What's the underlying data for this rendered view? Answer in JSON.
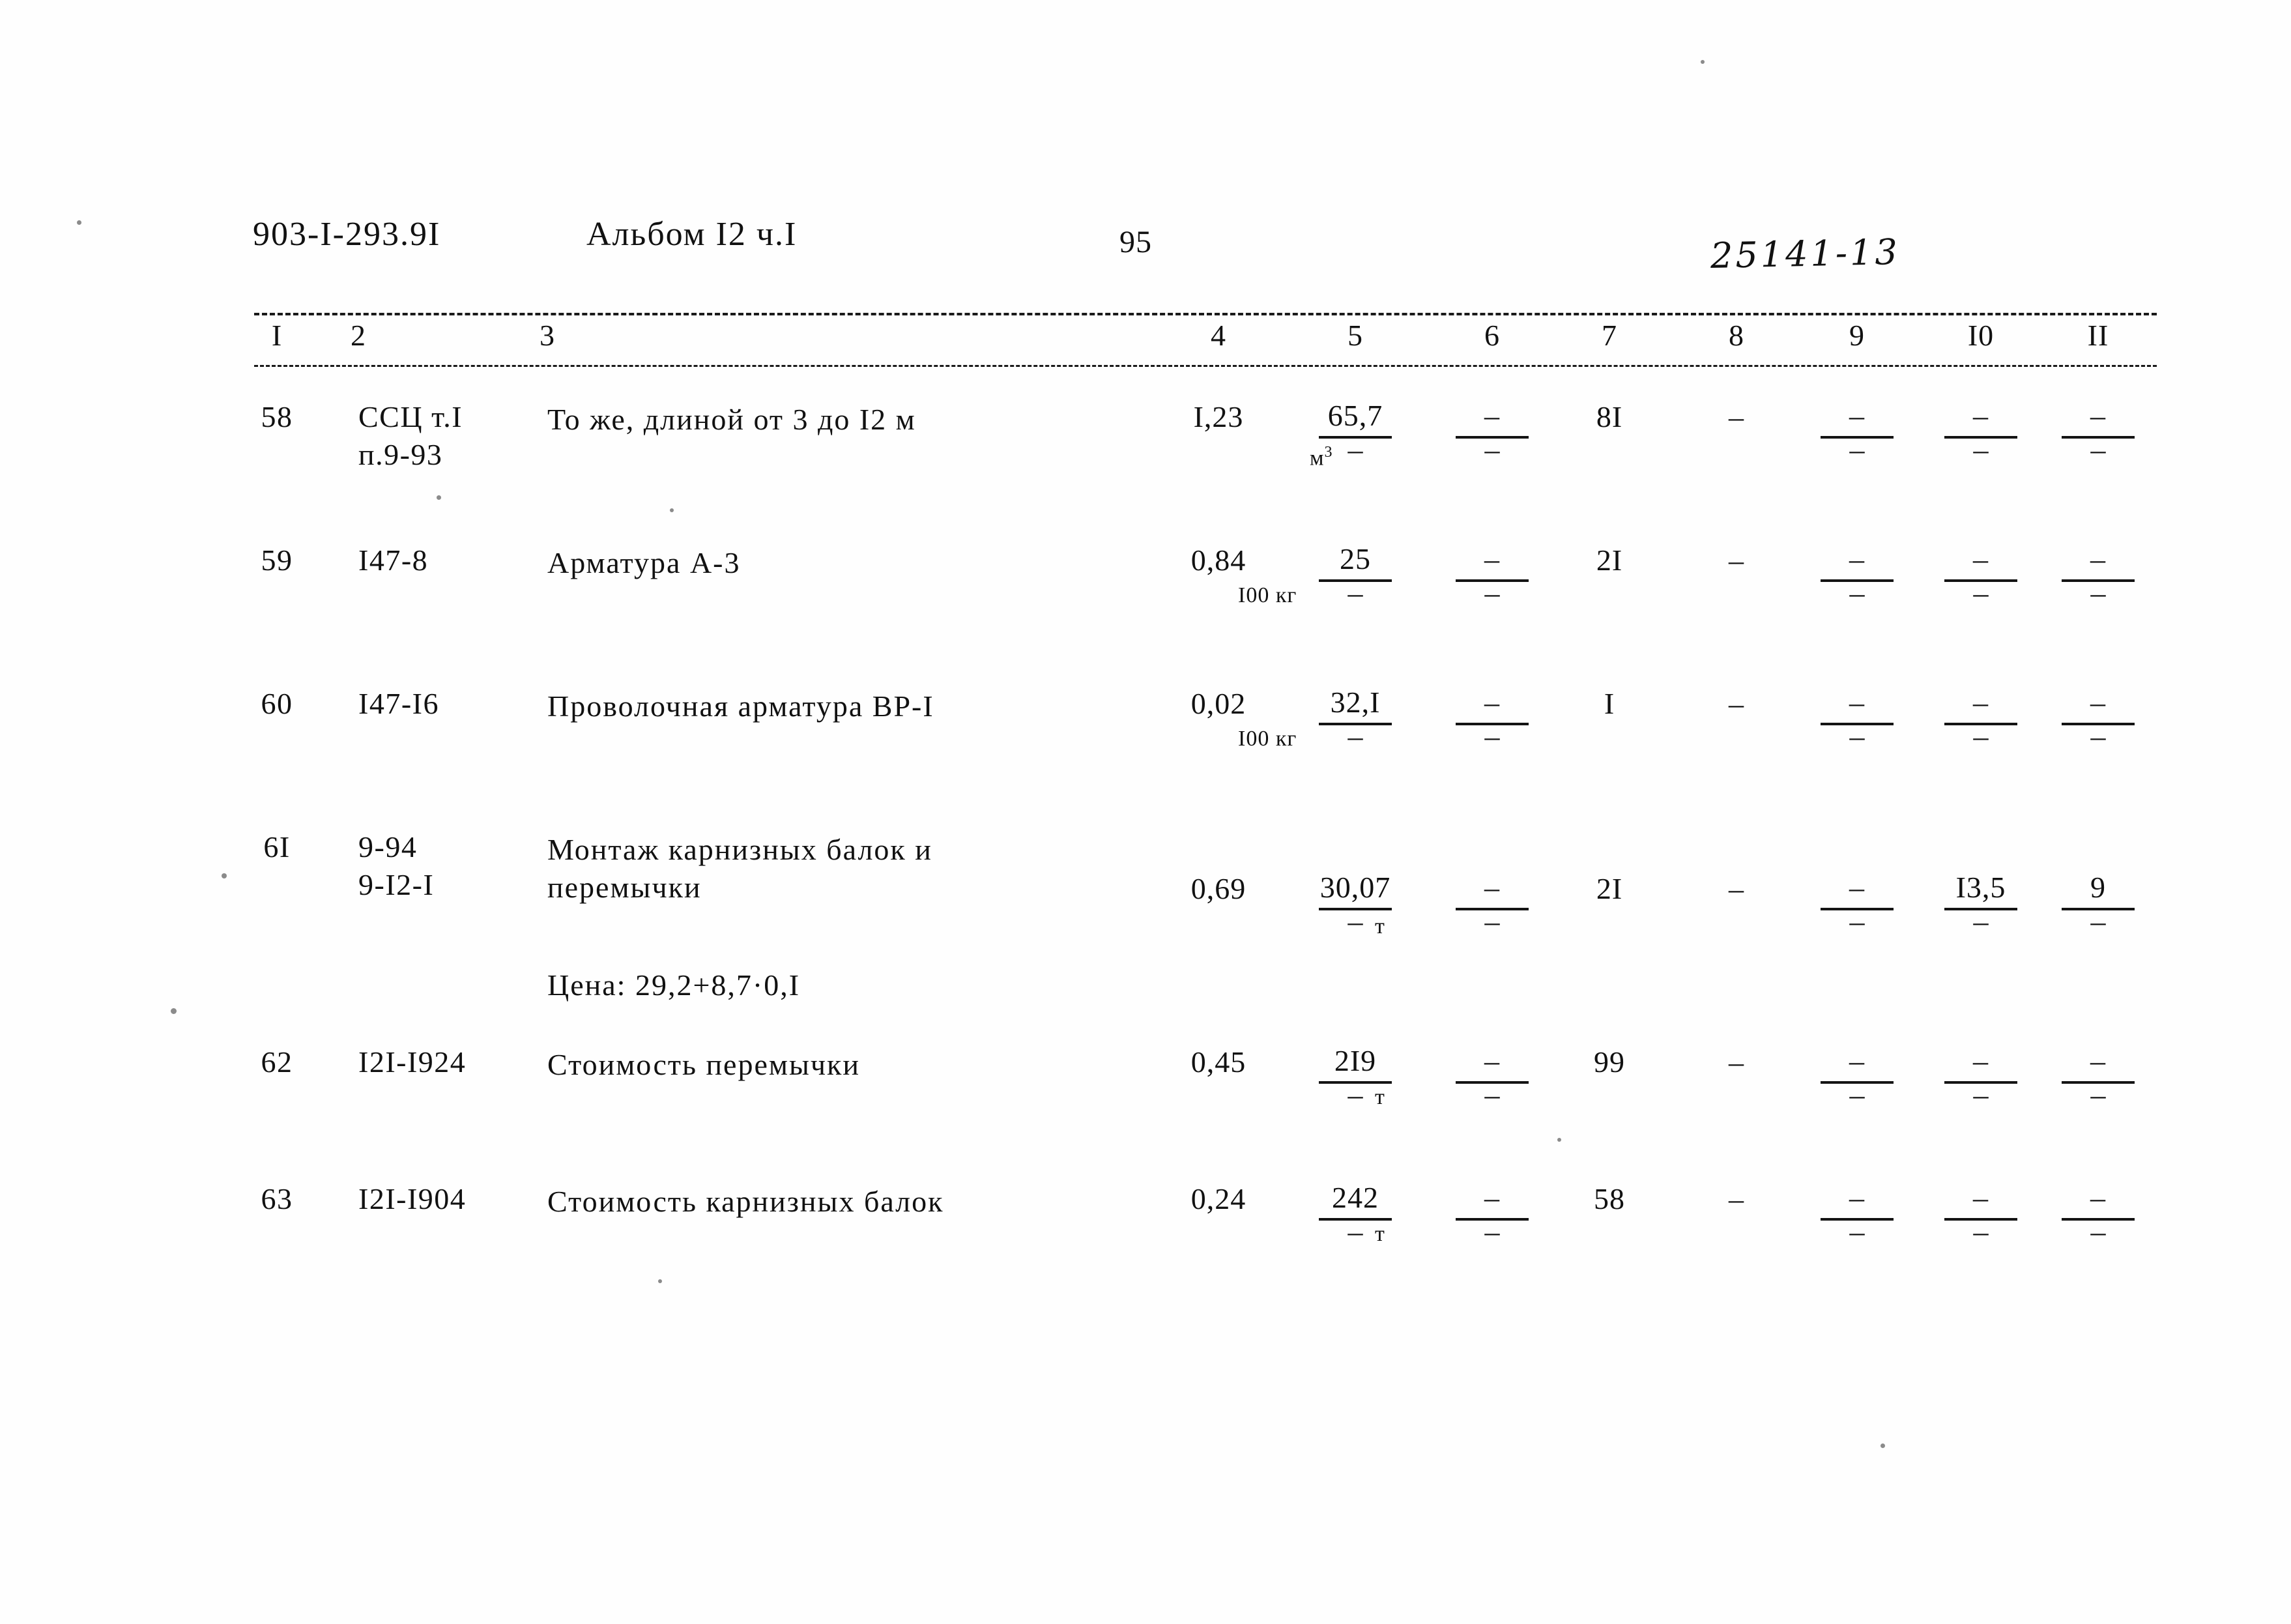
{
  "header": {
    "doc_code": "903-I-293.9I",
    "album": "Альбом I2 ч.I",
    "page_number": "95",
    "stamp": "25141-13"
  },
  "table": {
    "column_headers": [
      "I",
      "2",
      "3",
      "4",
      "5",
      "6",
      "7",
      "8",
      "9",
      "I0",
      "II"
    ],
    "rows": [
      {
        "no": "58",
        "code_line1": "ССЦ т.I",
        "code_line2": "п.9-93",
        "desc_line1": "То же, длиной от 3 до I2 м",
        "desc_line2": "",
        "unit": "м",
        "unit_sup": "3",
        "note": "",
        "c4": "I,23",
        "c5_top": "65,7",
        "c5_bot": "–",
        "c6_top": "–",
        "c6_bot": "–",
        "c7": "8I",
        "c8": "–",
        "c9_top": "–",
        "c9_bot": "–",
        "c10_top": "–",
        "c10_bot": "–",
        "c11_top": "–",
        "c11_bot": "–"
      },
      {
        "no": "59",
        "code_line1": "I47-8",
        "code_line2": "",
        "desc_line1": "Арматура А-3",
        "desc_line2": "",
        "unit": "I00 кг",
        "unit_sup": "",
        "note": "",
        "c4": "0,84",
        "c5_top": "25",
        "c5_bot": "–",
        "c6_top": "–",
        "c6_bot": "–",
        "c7": "2I",
        "c8": "–",
        "c9_top": "–",
        "c9_bot": "–",
        "c10_top": "–",
        "c10_bot": "–",
        "c11_top": "–",
        "c11_bot": "–"
      },
      {
        "no": "60",
        "code_line1": "I47-I6",
        "code_line2": "",
        "desc_line1": "Проволочная арматура ВР-I",
        "desc_line2": "",
        "unit": "I00 кг",
        "unit_sup": "",
        "note": "",
        "c4": "0,02",
        "c5_top": "32,I",
        "c5_bot": "–",
        "c6_top": "–",
        "c6_bot": "–",
        "c7": "I",
        "c8": "–",
        "c9_top": "–",
        "c9_bot": "–",
        "c10_top": "–",
        "c10_bot": "–",
        "c11_top": "–",
        "c11_bot": "–"
      },
      {
        "no": "6I",
        "code_line1": "9-94",
        "code_line2": "9-I2-I",
        "desc_line1": "Монтаж карнизных балок и",
        "desc_line2": "перемычки",
        "unit": "т",
        "unit_sup": "",
        "note": "Цена: 29,2+8,7·0,I",
        "c4": "0,69",
        "c5_top": "30,07",
        "c5_bot": "–",
        "c6_top": "–",
        "c6_bot": "–",
        "c7": "2I",
        "c8": "–",
        "c9_top": "–",
        "c9_bot": "–",
        "c10_top": "I3,5",
        "c10_bot": "–",
        "c11_top": "9",
        "c11_bot": "–"
      },
      {
        "no": "62",
        "code_line1": "I2I-I924",
        "code_line2": "",
        "desc_line1": "Стоимость перемычки",
        "desc_line2": "",
        "unit": "т",
        "unit_sup": "",
        "note": "",
        "c4": "0,45",
        "c5_top": "2I9",
        "c5_bot": "–",
        "c6_top": "–",
        "c6_bot": "–",
        "c7": "99",
        "c8": "–",
        "c9_top": "–",
        "c9_bot": "–",
        "c10_top": "–",
        "c10_bot": "–",
        "c11_top": "–",
        "c11_bot": "–"
      },
      {
        "no": "63",
        "code_line1": "I2I-I904",
        "code_line2": "",
        "desc_line1": "Стоимость карнизных балок",
        "desc_line2": "",
        "unit": "т",
        "unit_sup": "",
        "note": "",
        "c4": "0,24",
        "c5_top": "242",
        "c5_bot": "–",
        "c6_top": "–",
        "c6_bot": "–",
        "c7": "58",
        "c8": "–",
        "c9_top": "–",
        "c9_bot": "–",
        "c10_top": "–",
        "c10_bot": "–",
        "c11_top": "–",
        "c11_bot": "–"
      }
    ]
  }
}
